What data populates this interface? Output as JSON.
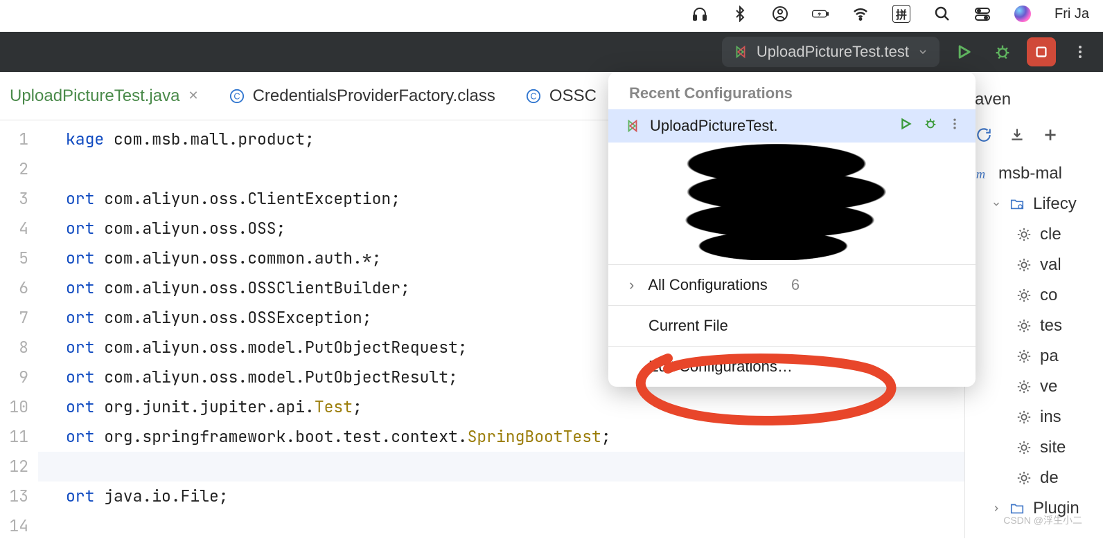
{
  "macmenu": {
    "day": "Fri Ja",
    "ime": "拼"
  },
  "toolbar": {
    "run_config_label": "UploadPictureTest.test"
  },
  "tabs": [
    {
      "label": "UploadPictureTest.java",
      "active": true,
      "closable": true,
      "icon": "none"
    },
    {
      "label": "CredentialsProviderFactory.class",
      "active": false,
      "icon": "c"
    },
    {
      "label": "OSSC",
      "active": false,
      "icon": "c"
    }
  ],
  "editor": {
    "lines": [
      {
        "n": "1",
        "pre": "kage",
        "txt": " com.msb.mall.product;"
      },
      {
        "n": "2",
        "txt": ""
      },
      {
        "n": "3",
        "pre": "ort",
        "txt": " com.aliyun.oss.ClientException;"
      },
      {
        "n": "4",
        "pre": "ort",
        "txt": " com.aliyun.oss.OSS;"
      },
      {
        "n": "5",
        "pre": "ort",
        "txt": " com.aliyun.oss.common.auth.*;"
      },
      {
        "n": "6",
        "pre": "ort",
        "txt": " com.aliyun.oss.OSSClientBuilder;"
      },
      {
        "n": "7",
        "pre": "ort",
        "txt": " com.aliyun.oss.OSSException;"
      },
      {
        "n": "8",
        "pre": "ort",
        "txt": " com.aliyun.oss.model.PutObjectRequest;"
      },
      {
        "n": "9",
        "pre": "ort",
        "txt": " com.aliyun.oss.model.PutObjectResult;"
      },
      {
        "n": "10",
        "pre": "ort",
        "txt": " org.junit.jupiter.api.",
        "cls": "Test",
        "post": ";"
      },
      {
        "n": "11",
        "pre": "ort",
        "txt": " org.springframework.boot.test.context.",
        "cls": "SpringBootTest",
        "post": ";"
      },
      {
        "n": "12",
        "txt": "",
        "hl": true
      },
      {
        "n": "13",
        "pre": "ort",
        "txt": " java.io.File;"
      },
      {
        "n": "14",
        "txt": ""
      }
    ]
  },
  "popup": {
    "header": "Recent Configurations",
    "selected_name": "UploadPictureTest.",
    "all_cfg_label": "All Configurations",
    "all_cfg_count": "6",
    "current_file": "Current File",
    "edit": "Edit Configurations…"
  },
  "maven": {
    "title": "aven",
    "project": "msb-mal",
    "lifecycle_label": "Lifecy",
    "goals": [
      "cle",
      "val",
      "co",
      "tes",
      "pa",
      "ve",
      "ins",
      "site",
      "de"
    ],
    "plugins": "Plugin"
  },
  "watermark": "CSDN @浮生小二"
}
